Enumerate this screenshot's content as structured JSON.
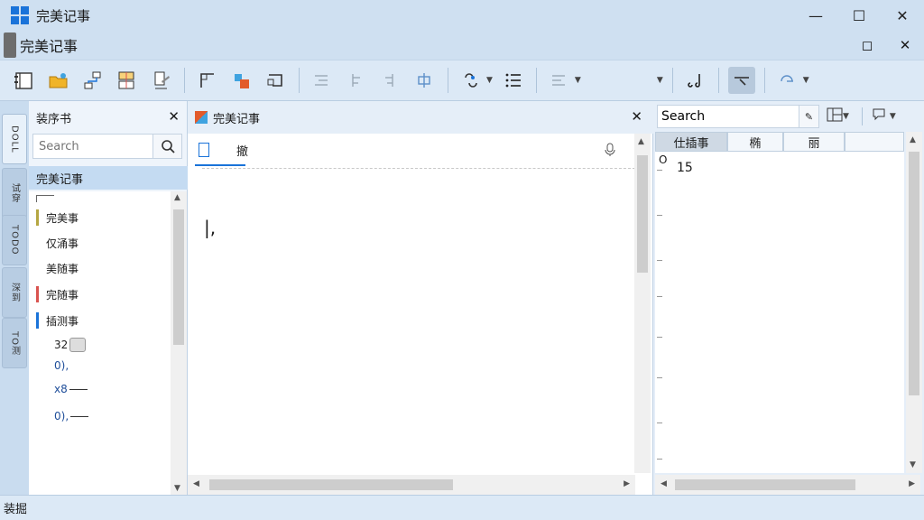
{
  "app": {
    "title": "完美记事"
  },
  "document": {
    "title": "完美记事"
  },
  "left_panel": {
    "header": "装序书",
    "search_placeholder": "Search",
    "selected_item": "完美记事",
    "items": [
      {
        "label": "完美事",
        "color": "#b5a642"
      },
      {
        "label": "仅涌事",
        "color": ""
      },
      {
        "label": "美随事",
        "color": ""
      },
      {
        "label": "完随事",
        "color": "#d9534f"
      },
      {
        "label": "插测事",
        "color": "#1a73d9"
      }
    ],
    "subitems": [
      "32",
      "0),",
      "x8",
      "0),"
    ]
  },
  "vertical_tabs": [
    "DOLL",
    "试穿",
    "TODO",
    "深到",
    "TO测"
  ],
  "editor": {
    "tab_title": "完美记事",
    "sub_label": "撤",
    "body_text": "|,"
  },
  "right_panel": {
    "search_value": "Search",
    "tabs": [
      "仕插事",
      "椭",
      "丽",
      ""
    ],
    "circle": "O",
    "value": "15"
  },
  "statusbar": {
    "text": "装掘"
  }
}
